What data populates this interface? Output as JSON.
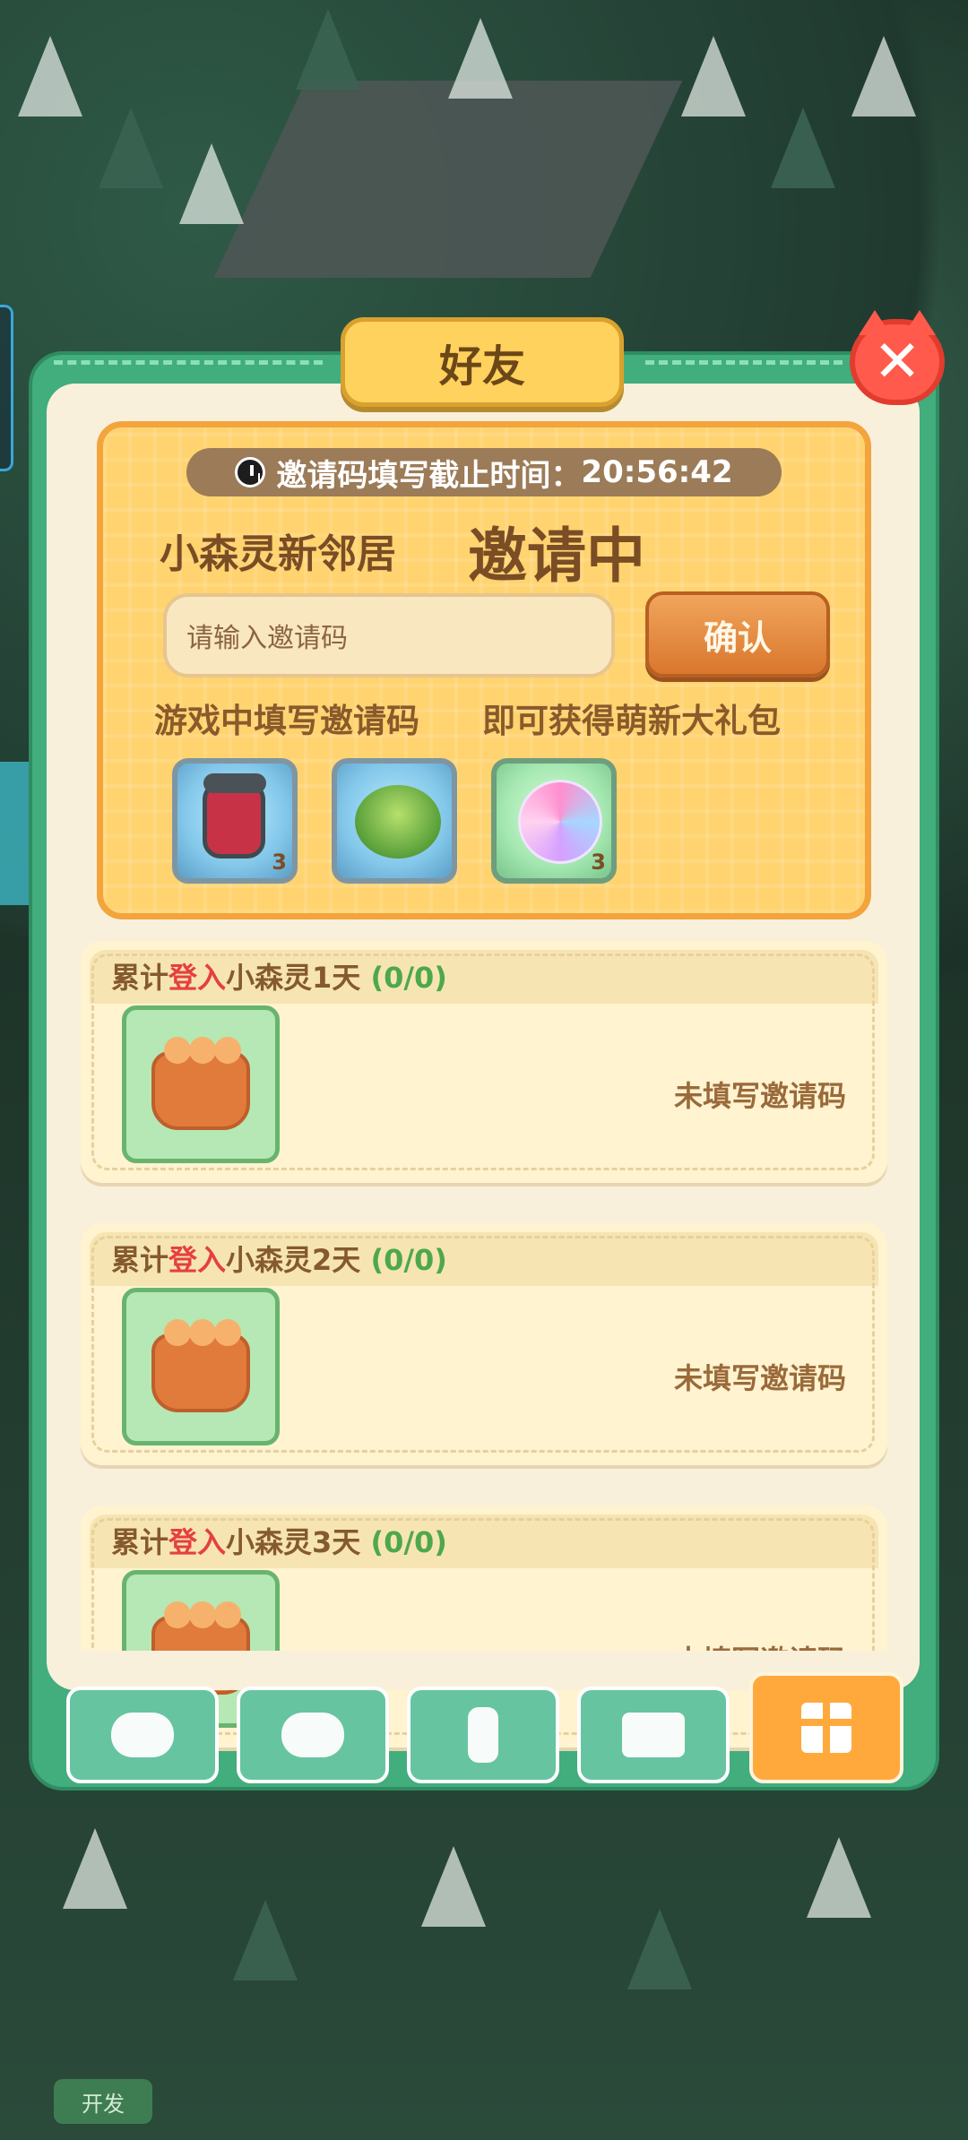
{
  "window": {
    "title": "好友"
  },
  "invite": {
    "timer_label": "邀请码填写截止时间：",
    "timer_value": "20:56:42",
    "subtitle_small": "小森灵新邻居",
    "subtitle_big": "邀请中",
    "input_placeholder": "请输入邀请码",
    "confirm_label": "确认",
    "hint_left": "游戏中填写邀请码",
    "hint_right": "即可获得萌新大礼包",
    "rewards": [
      {
        "name": "pot-icon",
        "qty": "3"
      },
      {
        "name": "bush-icon",
        "qty": ""
      },
      {
        "name": "orb-icon",
        "qty": "3"
      }
    ]
  },
  "tasks": [
    {
      "prefix": "累计",
      "highlight": "登入",
      "suffix": "小森灵1天",
      "progress": "(0/0)",
      "status": "未填写邀请码"
    },
    {
      "prefix": "累计",
      "highlight": "登入",
      "suffix": "小森灵2天",
      "progress": "(0/0)",
      "status": "未填写邀请码"
    },
    {
      "prefix": "累计",
      "highlight": "登入",
      "suffix": "小森灵3天",
      "progress": "(0/0)",
      "status": "未填写邀请码"
    }
  ],
  "bottom_tabs": [
    {
      "name": "friends-tab"
    },
    {
      "name": "chat-tab"
    },
    {
      "name": "tools-tab"
    },
    {
      "name": "guide-tab"
    },
    {
      "name": "gift-tab",
      "active": true
    }
  ],
  "dev_label": "开发",
  "colors": {
    "accent": "#42ad7d",
    "title_bg": "#ffd15d",
    "active_tab": "#ffa93d"
  }
}
